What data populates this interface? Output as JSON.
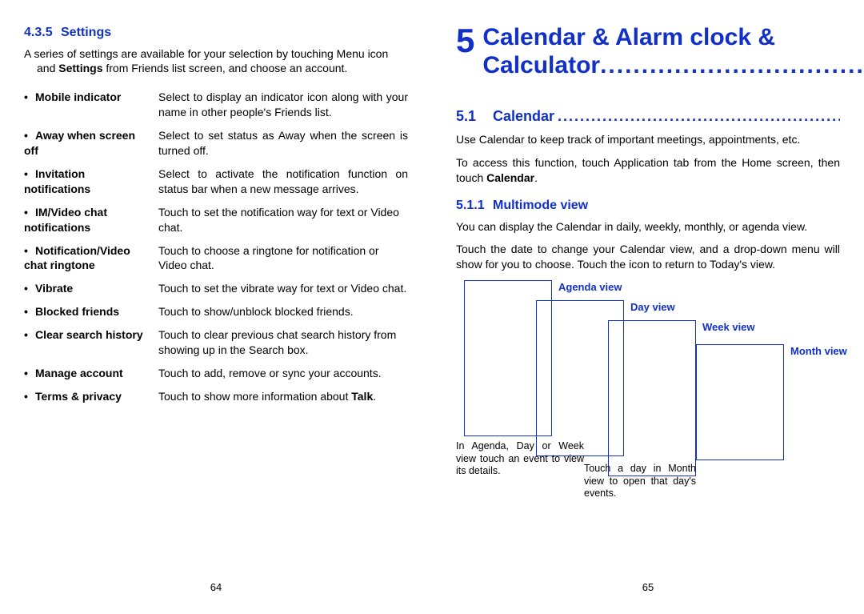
{
  "left": {
    "heading_num": "4.3.5",
    "heading_text": "Settings",
    "intro_line1": "A series of settings are available for your selection by touching Menu icon",
    "intro_line2_a": "and ",
    "intro_line2_b": "Settings",
    "intro_line2_c": " from Friends list screen, and choose an account.",
    "rows": [
      {
        "label": "Mobile indicator",
        "desc": "Select to display an indicator icon along with your name in other people's Friends list.",
        "justify": true
      },
      {
        "label": "Away when screen off",
        "desc": "Select to set status as Away when the screen is turned off.",
        "justify": true
      },
      {
        "label": "Invitation notifications",
        "desc": "Select to activate the notification function on status bar when a new message arrives.",
        "justify": true
      },
      {
        "label": "IM/Video chat notifications",
        "desc": "Touch to set the notification way for text or Video chat."
      },
      {
        "label": "Notification/Video chat ringtone",
        "desc": "Touch to choose a ringtone for notification or Video chat."
      },
      {
        "label": "Vibrate",
        "desc": "Touch to set the vibrate way for text or Video chat."
      },
      {
        "label": "Blocked friends",
        "desc": "Touch to show/unblock blocked friends."
      },
      {
        "label": "Clear search history",
        "desc": "Touch to clear previous chat search history from showing up in the Search box."
      },
      {
        "label": "Manage account",
        "desc": "Touch to add, remove or sync your accounts."
      },
      {
        "label": "Terms & privacy",
        "desc_a": "Touch to show more information about ",
        "desc_b": "Talk",
        "desc_c": "."
      }
    ],
    "page_number": "64"
  },
  "right": {
    "chapter_num": "5",
    "chapter_title": "Calendar & Alarm clock & Calculator",
    "sec_num": "5.1",
    "sec_title": "Calendar",
    "p1": "Use Calendar to keep track of important meetings, appointments, etc.",
    "p2_a": "To access this function, touch Application tab from the Home screen, then touch ",
    "p2_b": "Calendar",
    "p2_c": ".",
    "subsec_num": "5.1.1",
    "subsec_title": "Multimode view",
    "p3": "You can display the Calendar in daily, weekly, monthly, or agenda view.",
    "p4": "Touch the date to change your Calendar view, and a drop-down menu will show for you to choose. Touch the icon        to return to Today's view.",
    "labels": {
      "agenda": "Agenda view",
      "day": "Day view",
      "week": "Week view",
      "month": "Month view"
    },
    "cap1": "In Agenda, Day or Week view touch an event to view its details.",
    "cap2": "Touch a day in Month view to open that day's events.",
    "page_number": "65"
  }
}
